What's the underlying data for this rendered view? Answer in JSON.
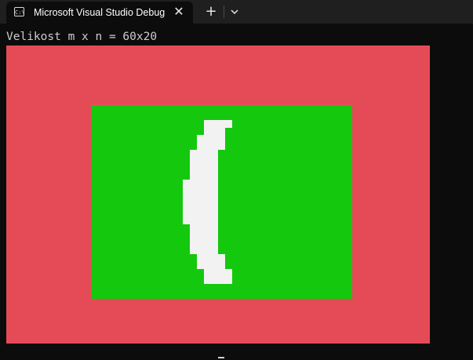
{
  "window": {
    "tab_title": "Microsoft Visual Studio Debug Console",
    "tab_icon_text": "C:\\",
    "close_symbol": "✕",
    "new_tab_symbol": "+"
  },
  "console": {
    "output_line": "Velikost m x n = 60x20"
  },
  "colors": {
    "red": "#e54b57",
    "green": "#14c80e",
    "white": "#f2f2f2"
  }
}
